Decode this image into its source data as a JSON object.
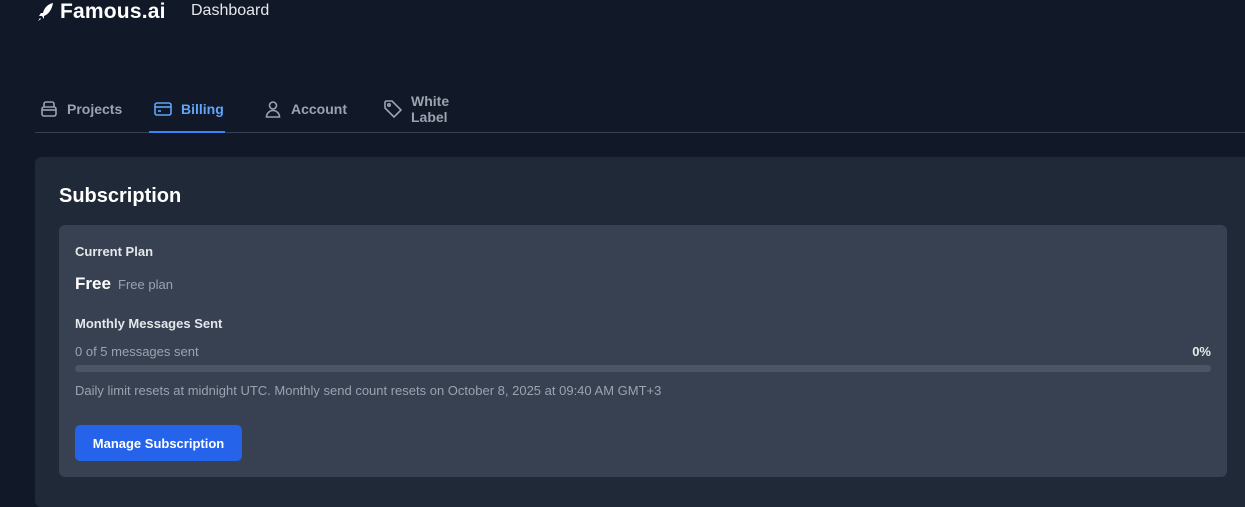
{
  "app": {
    "brand": "Famous.ai",
    "nav_dashboard": "Dashboard"
  },
  "tabs": [
    {
      "label": "Projects",
      "icon": "box-icon",
      "active": false
    },
    {
      "label": "Billing",
      "icon": "credit-card-icon",
      "active": true
    },
    {
      "label": "Account",
      "icon": "user-icon",
      "active": false
    },
    {
      "label": "White Label",
      "icon": "tag-icon",
      "active": false
    }
  ],
  "subscription": {
    "title": "Subscription",
    "current_plan_label": "Current Plan",
    "plan_name": "Free",
    "plan_description": "Free plan",
    "monthly_label": "Monthly Messages Sent",
    "messages_text": "0 of 5 messages sent",
    "percent_text": "0%",
    "progress_fraction": 0,
    "reset_note": "Daily limit resets at midnight UTC. Monthly send count resets on October 8, 2025 at 09:40 AM GMT+3",
    "manage_button": "Manage Subscription"
  },
  "colors": {
    "background": "#111827",
    "card": "#1f2937",
    "inner_panel": "#374151",
    "accent": "#3b82f6",
    "button": "#2563eb"
  }
}
